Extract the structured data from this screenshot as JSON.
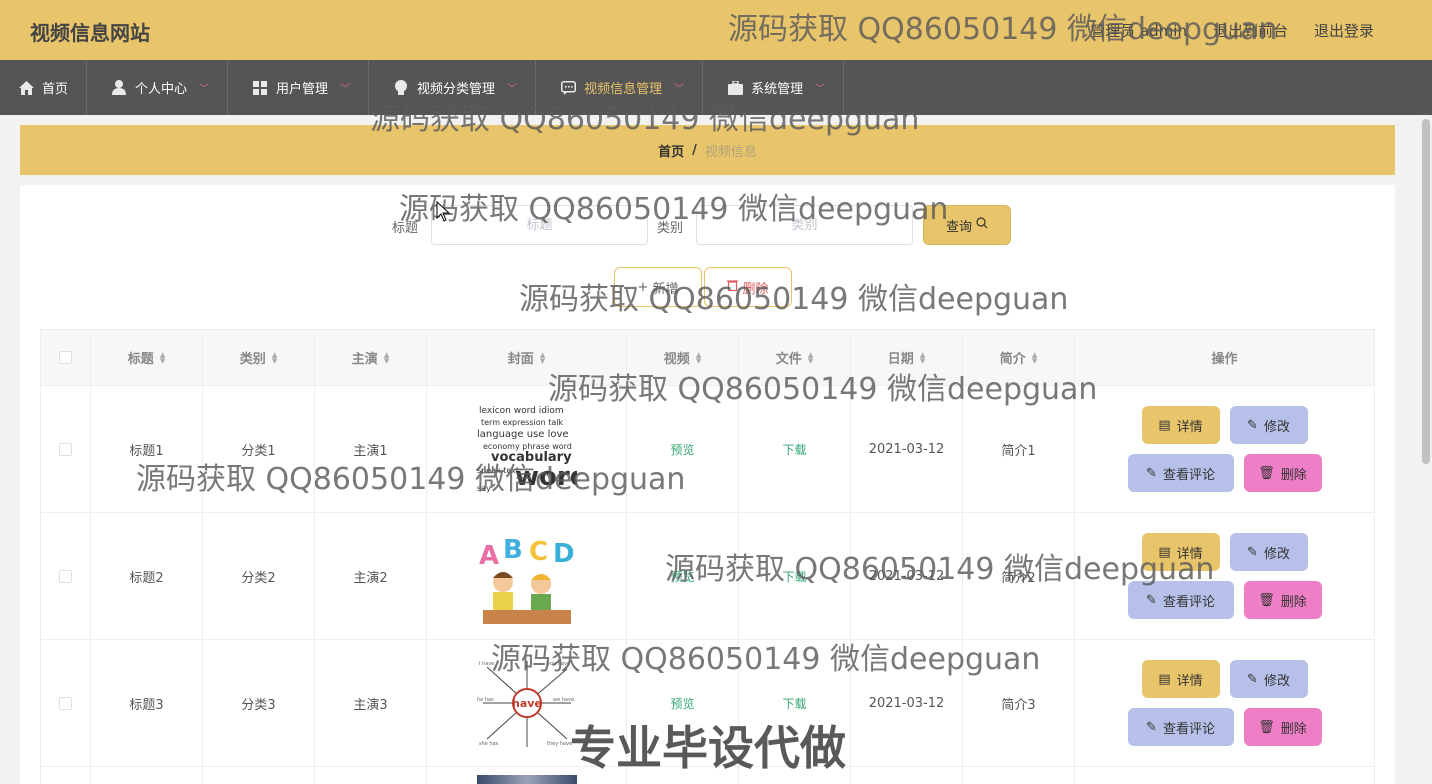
{
  "header": {
    "site_title": "视频信息网站",
    "admin": "管理员 admin",
    "to_front": "退出到前台",
    "logout": "退出登录"
  },
  "nav": {
    "items": [
      {
        "label": "首页",
        "icon": "home-icon"
      },
      {
        "label": "个人中心",
        "icon": "user-icon"
      },
      {
        "label": "用户管理",
        "icon": "grid-icon"
      },
      {
        "label": "视频分类管理",
        "icon": "bulb-icon"
      },
      {
        "label": "视频信息管理",
        "icon": "chat-icon"
      },
      {
        "label": "系统管理",
        "icon": "briefcase-icon"
      }
    ],
    "active_index": 4
  },
  "breadcrumb": {
    "home": "首页",
    "sep": "/",
    "current": "视频信息"
  },
  "search": {
    "title_label": "标题",
    "title_placeholder": "标题",
    "category_label": "类别",
    "category_placeholder": "类别",
    "query_button": "查询"
  },
  "actions": {
    "add": "新增",
    "delete": "删除"
  },
  "table": {
    "headers": [
      "标题",
      "类别",
      "主演",
      "封面",
      "视频",
      "文件",
      "日期",
      "简介",
      "操作"
    ],
    "rows": [
      {
        "title": "标题1",
        "category": "分类1",
        "actor": "主演1",
        "cover": "vocabulary words",
        "video": "预览",
        "file": "下载",
        "date": "2021-03-12",
        "intro": "简介1"
      },
      {
        "title": "标题2",
        "category": "分类2",
        "actor": "主演2",
        "cover": "A B C D",
        "video": "预览",
        "file": "下载",
        "date": "2021-03-12",
        "intro": "简介2"
      },
      {
        "title": "标题3",
        "category": "分类3",
        "actor": "主演3",
        "cover": "have",
        "video": "预览",
        "file": "下载",
        "date": "2021-03-12",
        "intro": "简介3"
      }
    ],
    "row_buttons": {
      "detail": "详情",
      "edit": "修改",
      "comment": "查看评论",
      "delete": "删除"
    }
  },
  "watermarks": {
    "text": "源码获取 QQ86050149 微信deepguan",
    "big": "专业毕设代做"
  },
  "colors": {
    "header": "#e8c46a",
    "nav": "#555555",
    "active": "#e8c46a",
    "link": "#35a572",
    "delete_btn": "#ee7fc6",
    "edit_btn": "#b6c0e8"
  }
}
